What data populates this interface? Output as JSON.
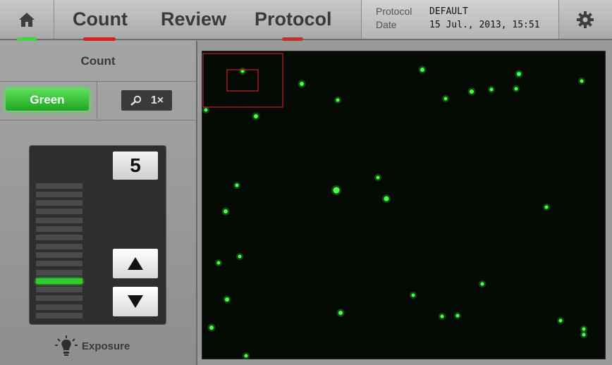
{
  "header": {
    "tabs": [
      {
        "label": "Count"
      },
      {
        "label": "Review"
      },
      {
        "label": "Protocol"
      }
    ],
    "protocol_label": "Protocol",
    "protocol_value": "DEFAULT",
    "date_label": "Date",
    "date_value": "15 Jul., 2013, 15:51"
  },
  "left_panel": {
    "title": "Count",
    "channel_button": "Green",
    "zoom_label": "1×",
    "exposure": {
      "value": "5",
      "level": 5,
      "max_level": 16,
      "label": "Exposure"
    }
  },
  "colors": {
    "accent_green": "#2ecc2e",
    "active_tab_indicator": "#d92020",
    "cell_color": "#46ff46",
    "roi_color": "#c0222a"
  },
  "icons": [
    "home-icon",
    "gear-icon",
    "magnifier-icon",
    "up-arrow-icon",
    "down-arrow-icon",
    "lightbulb-icon"
  ]
}
